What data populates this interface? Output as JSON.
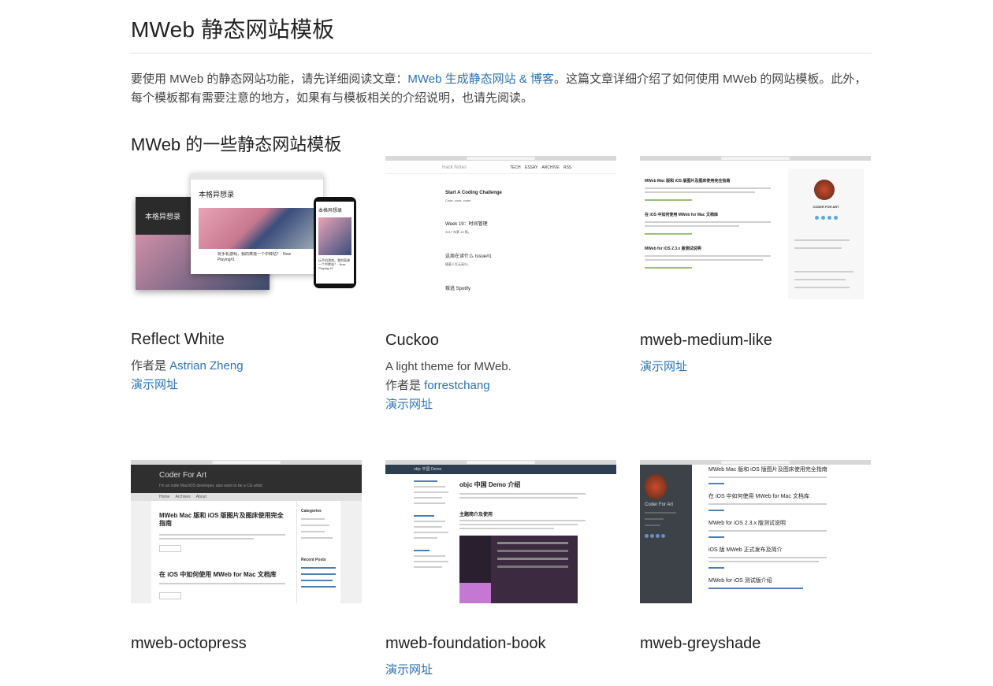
{
  "page": {
    "title": "MWeb 静态网站模板",
    "intro_before": "要使用 MWeb 的静态网站功能，请先详细阅读文章：",
    "intro_link": "MWeb 生成静态网站 & 博客",
    "intro_after": "。这篇文章详细介绍了如何使用 MWeb 的网站模板。此外，每个模板都有需要注意的地方，如果有与模板相关的介绍说明，也请先阅读。",
    "section_title": "MWeb 的一些静态网站模板"
  },
  "templates": [
    {
      "name": "Reflect White",
      "author_prefix": "作者是 ",
      "author": "Astrian Zheng",
      "demo": "演示网址",
      "thumb": {
        "title": "本格异想录",
        "caption": "玩手机游戏，我的离谱一个中转站？· Now Playing#1",
        "phone_title": "本格异想录",
        "phone_caption": "玩手机游戏，我的离谱一个中转站？· Now Playing #1"
      }
    },
    {
      "name": "Cuckoo",
      "desc": "A light theme for MWeb.",
      "author_prefix": "作者是 ",
      "author": "forrestchang",
      "demo": "演示网址",
      "thumb": {
        "brand": "Hack Notes",
        "nav": [
          "TECH",
          "ESSAY",
          "ARCHIVE",
          "RSS"
        ],
        "posts": [
          {
            "title": "Start A Coding Challenge",
            "sub": "Code, code, code!"
          },
          {
            "title": "Week 19：时间管理",
            "sub": "2017 年第 19 周。"
          },
          {
            "title": "这周在读什么 Issue#1",
            "sub": "随意人生无高兴。"
          },
          {
            "title": "叛逃 Spotify",
            "sub": ""
          }
        ]
      }
    },
    {
      "name": "mweb-medium-like",
      "demo": "演示网址",
      "thumb": {
        "posts": [
          "MWeb Mac 版和 iOS 版图片及图床使用完全指南",
          "在 iOS 中如何使用 MWeb for Mac 文档库",
          "MWeb for iOS 2.3.x 版测试说明"
        ],
        "sidebar_name": "CODER FOR ART"
      }
    },
    {
      "name": "mweb-octopress",
      "thumb": {
        "brand": "Coder For Art",
        "tagline": "I'm an indie Mac/iOS developer, also want to be a CG artist",
        "nav": [
          "Home",
          "Archives",
          "About"
        ],
        "posts": [
          "MWeb Mac 版和 iOS 版图片及图床使用完全指南",
          "在 iOS 中如何使用 MWeb for Mac 文档库"
        ],
        "side_title": "Categories",
        "side_title2": "Recent Posts"
      }
    },
    {
      "name": "mweb-foundation-book",
      "demo": "演示网址",
      "thumb": {
        "header": "objc 中国 Demo",
        "title": "objc 中国 Demo 介绍",
        "sub": "主题简介及使用"
      }
    },
    {
      "name": "mweb-greyshade",
      "thumb": {
        "brand": "Coder For Art",
        "posts": [
          "MWeb Mac 版和 iOS 版图片及图床使用完全指南",
          "在 iOS 中如何使用 MWeb for Mac 文档库",
          "MWeb for iOS 2.3.x 版测试说明",
          "iOS 版 MWeb 正式发布及简介",
          "MWeb for iOS 测试版介绍"
        ]
      }
    }
  ],
  "colors": {
    "link": "#2a73b8",
    "text": "#444444",
    "rule": "#e5e5e5"
  }
}
